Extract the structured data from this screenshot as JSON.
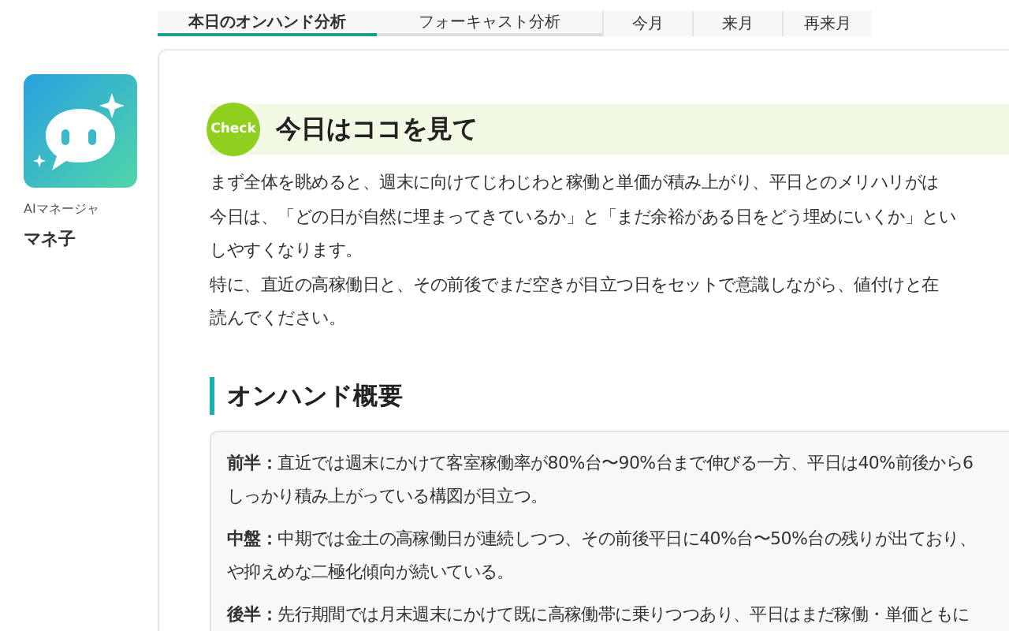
{
  "analysis_tabs": [
    {
      "label": "本日のオンハンド分析",
      "selected": true
    },
    {
      "label": "フォーキャスト分析",
      "selected": false
    }
  ],
  "period_tabs": [
    {
      "label": "今月",
      "selected": false
    },
    {
      "label": "来月",
      "selected": false
    },
    {
      "label": "再来月",
      "selected": false
    }
  ],
  "assistant": {
    "role": "AIマネージャ",
    "name": "マネ子"
  },
  "check_section": {
    "badge": "Check",
    "title": "今日はココを見て",
    "lines": [
      "まず全体を眺めると、週末に向けてじわじわと稼働と単価が積み上がり、平日とのメリハリがは",
      "今日は、「どの日が自然に埋まってきているか」と「まだ余裕がある日をどう埋めにいくか」とい",
      "しやすくなります。",
      "特に、直近の高稼働日と、その前後でまだ空きが目立つ日をセットで意識しながら、値付けと在",
      "読んでください。"
    ]
  },
  "overview": {
    "title": "オンハンド概要",
    "items": [
      {
        "label": "前半：",
        "lines": [
          "直近では週末にかけて客室稼働率が80%台〜90%台まで伸びる一方、平日は40%前後から6",
          "しっかり積み上がっている構図が目立つ。"
        ]
      },
      {
        "label": "中盤：",
        "lines": [
          "中期では金土の高稼働日が連続しつつ、その前後平日に40%台〜50%台の残りが出ており、",
          "や抑えめな二極化傾向が続いている。"
        ]
      },
      {
        "label": "後半：",
        "lines": [
          "先行期間では月末週末にかけて既に高稼働帯に乗りつつあり、平日はまだ稼働・単価ともに"
        ]
      }
    ]
  }
}
